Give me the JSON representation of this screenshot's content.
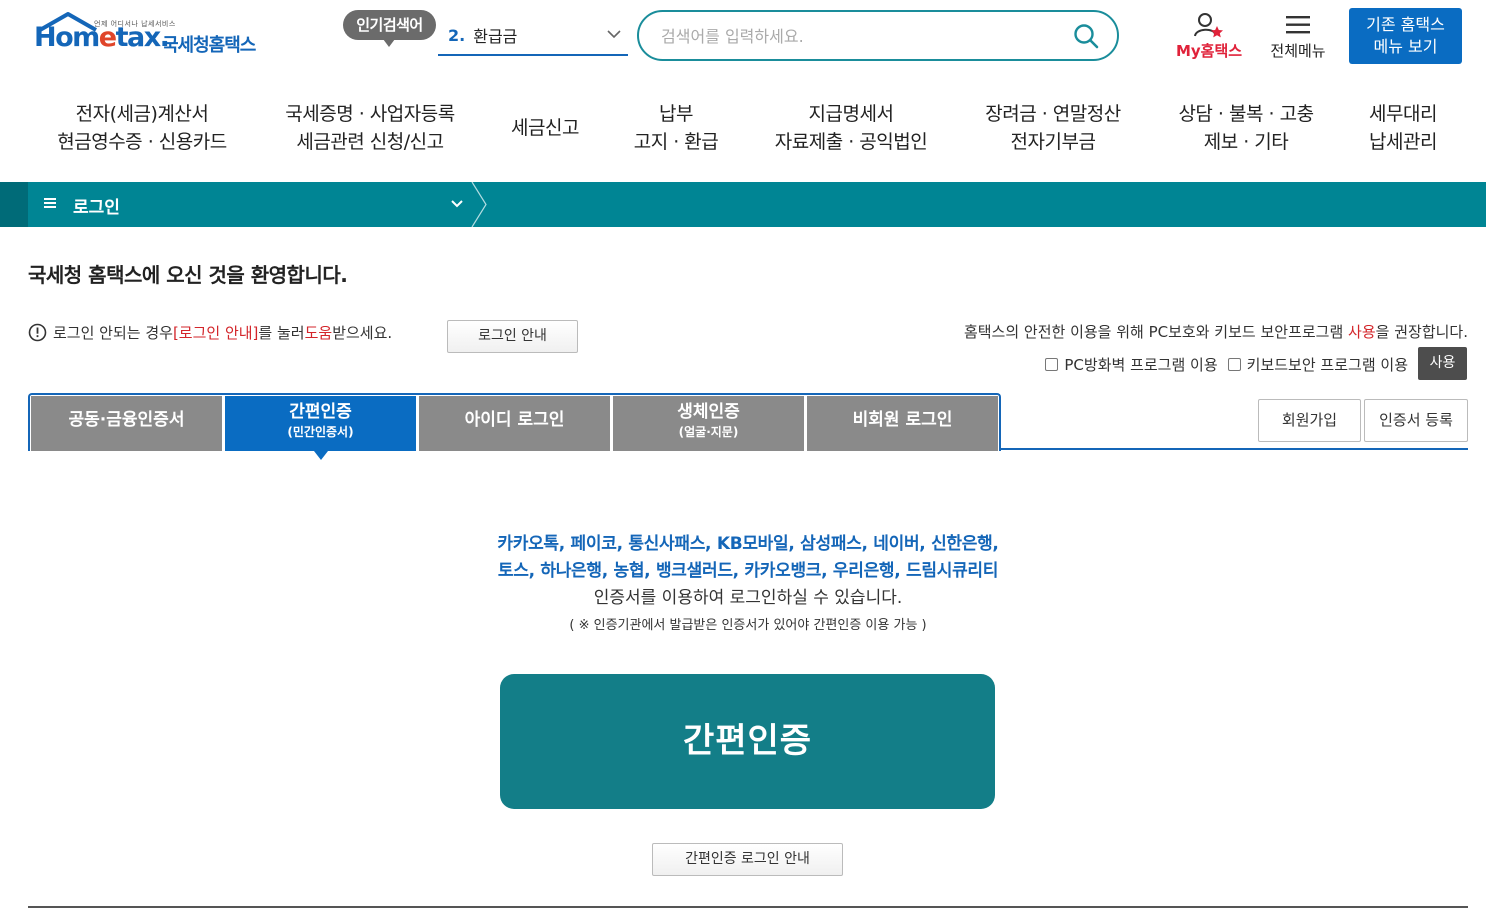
{
  "header": {
    "logo": {
      "tagline": "언제 어디서나 납세서비스",
      "home_text": "Hom",
      "e_text": "e",
      "tax_text": "tax.",
      "korean": "국세청홈택스"
    },
    "popular_badge": "인기검색어",
    "popular_keyword": {
      "number": "2.",
      "text": "환급금"
    },
    "search": {
      "placeholder": "검색어를 입력하세요."
    },
    "my_hometax": "My홈택스",
    "all_menu": "전체메뉴",
    "legacy_button": {
      "line1": "기존 홈택스",
      "line2": "메뉴 보기"
    }
  },
  "gnb": [
    {
      "line1": "전자(세금)계산서",
      "line2": "현금영수증 · 신용카드"
    },
    {
      "line1": "국세증명 · 사업자등록",
      "line2": "세금관련 신청/신고"
    },
    {
      "line1": "세금신고",
      "line2": ""
    },
    {
      "line1": "납부",
      "line2": "고지 · 환급"
    },
    {
      "line1": "지급명세서",
      "line2": "자료제출 · 공익법인"
    },
    {
      "line1": "장려금 · 연말정산",
      "line2": "전자기부금"
    },
    {
      "line1": "상담 · 불복 · 고충",
      "line2": "제보 · 기타"
    },
    {
      "line1": "세무대리",
      "line2": "납세관리"
    }
  ],
  "location": {
    "title": "로그인"
  },
  "welcome": "국세청 홈택스에 오신 것을 환영합니다.",
  "help": {
    "part1": "로그인 안되는 경우 ",
    "link": "[로그인 안내]",
    "part2": "를 눌러 ",
    "red": "도움",
    "part3": "받으세요.",
    "button": "로그인 안내"
  },
  "security": {
    "note_part1": "홈택스의 안전한 이용을 위해 PC보호와 키보드 보안프로그램 ",
    "note_red": "사용",
    "note_part2": "을 권장합니다.",
    "option1": "PC방화벽 프로그램 이용",
    "option2": "키보드보안 프로그램 이용",
    "use_button": "사용"
  },
  "tabs": [
    {
      "main": "공동·금융인증서",
      "sub": ""
    },
    {
      "main": "간편인증",
      "sub": "(민간인증서)"
    },
    {
      "main": "아이디 로그인",
      "sub": ""
    },
    {
      "main": "생체인증",
      "sub": "(얼굴·지문)"
    },
    {
      "main": "비회원 로그인",
      "sub": ""
    }
  ],
  "side_buttons": {
    "signup": "회원가입",
    "cert_register": "인증서 등록"
  },
  "content": {
    "providers_line1": "카카오톡, 페이코, 통신사패스, KB모바일, 삼성패스, 네이버, 신한은행,",
    "providers_line2": "토스, 하나은행, 농협, 뱅크샐러드, 카카오뱅크, 우리은행, 드림시큐리티",
    "desc": "인증서를 이용하여 로그인하실 수 있습니다.",
    "note": "( ※ 인증기관에서 발급받은 인증서가 있어야 간편인증 이용 가능 )",
    "main_button": "간편인증",
    "guide_button": "간편인증 로그인 안내"
  },
  "colors": {
    "brand_blue": "#1466b8",
    "teal": "#008594",
    "active_tab": "#0a6cc2",
    "red": "#d3262b"
  }
}
